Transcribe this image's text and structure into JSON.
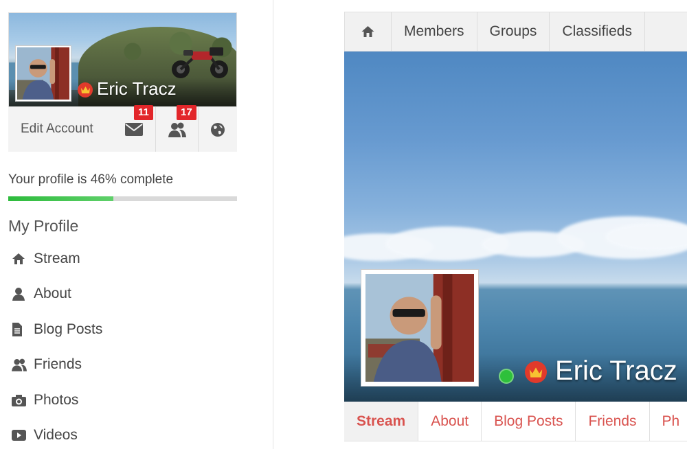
{
  "sidebar": {
    "user_name": "Eric Tracz",
    "edit_account_label": "Edit Account",
    "messages_badge": "11",
    "friend_requests_badge": "17",
    "profile_progress_text": "Your profile is 46% complete",
    "profile_progress_percent": 46,
    "my_profile_title": "My Profile",
    "nav_items": [
      {
        "label": "Stream",
        "icon": "home-icon"
      },
      {
        "label": "About",
        "icon": "user-icon"
      },
      {
        "label": "Blog Posts",
        "icon": "document-icon"
      },
      {
        "label": "Friends",
        "icon": "friends-icon"
      },
      {
        "label": "Photos",
        "icon": "camera-icon"
      },
      {
        "label": "Videos",
        "icon": "video-icon"
      }
    ]
  },
  "topnav": {
    "home_icon": "home-icon",
    "items": [
      "Members",
      "Groups",
      "Classifieds"
    ]
  },
  "profile_header": {
    "user_name": "Eric Tracz",
    "online_status": "online",
    "badge_icon": "crown-icon"
  },
  "tabs": {
    "items": [
      "Stream",
      "About",
      "Blog Posts",
      "Friends",
      "Ph"
    ],
    "active": "Stream"
  },
  "colors": {
    "accent_red": "#d9534f",
    "badge_red": "#e2262a",
    "progress_green": "#2dbb3c",
    "online_green": "#2ec03b",
    "crown_red": "#e13a2b",
    "crown_gold": "#f7c331"
  }
}
